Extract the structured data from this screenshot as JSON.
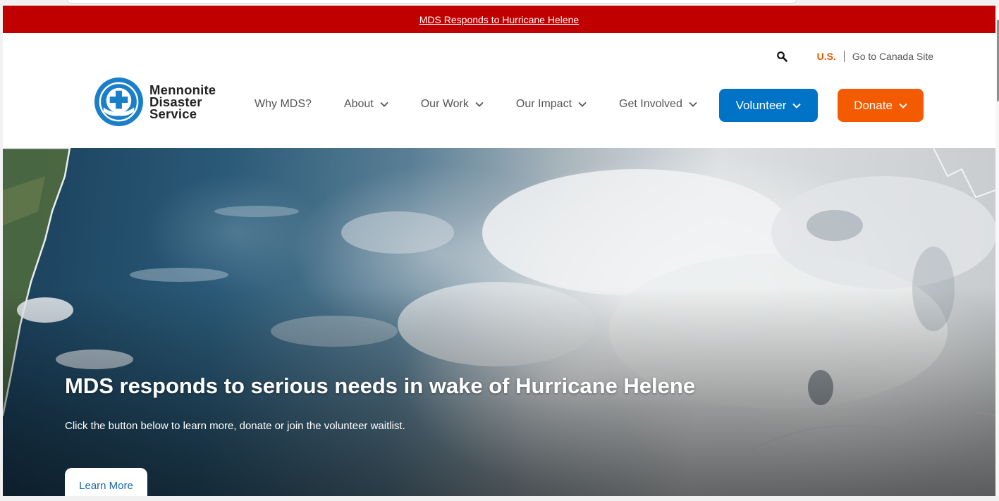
{
  "alert": {
    "link_text": "MDS Responds to Hurricane Helene"
  },
  "utility": {
    "search_icon": "search-icon",
    "current_country": "U.S.",
    "other_site": "Go to Canada Site"
  },
  "logo": {
    "line1": "Mennonite",
    "line2": "Disaster",
    "line3": "Service"
  },
  "nav": {
    "items": [
      {
        "label": "Why MDS?"
      },
      {
        "label": "About"
      },
      {
        "label": "Our Work"
      },
      {
        "label": "Our Impact"
      },
      {
        "label": "Get Involved"
      }
    ],
    "volunteer_label": "Volunteer",
    "donate_label": "Donate"
  },
  "hero": {
    "title": "MDS responds to serious needs in wake of Hurricane Helene",
    "subtitle": "Click the button below to learn more, donate or join the volunteer waitlist.",
    "cta_label": "Learn More"
  },
  "colors": {
    "alert_red": "#c00000",
    "volunteer_blue": "#0073c6",
    "donate_orange": "#f45b00",
    "country_orange": "#e05a00",
    "logo_blue": "#1a7fc9"
  }
}
